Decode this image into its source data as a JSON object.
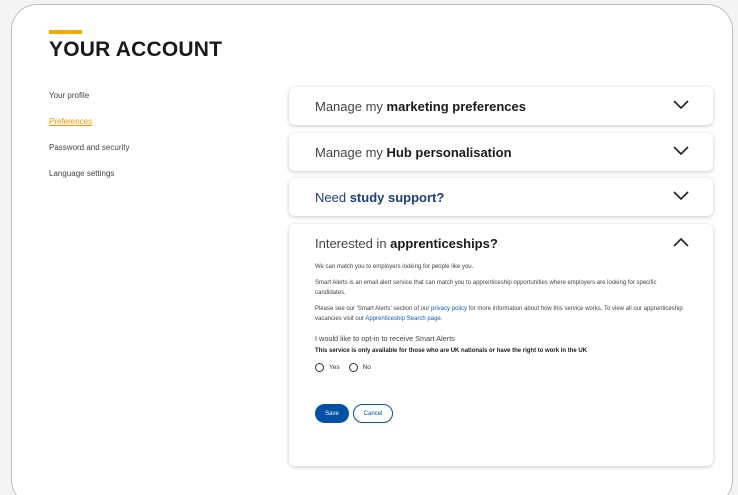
{
  "page": {
    "title": "YOUR ACCOUNT"
  },
  "nav": {
    "items": [
      {
        "label": "Your profile"
      },
      {
        "label": "Preferences",
        "active": true
      },
      {
        "label": "Password and security"
      },
      {
        "label": "Language settings"
      }
    ]
  },
  "accordions": [
    {
      "prefix": "Manage my ",
      "bold": "marketing preferences",
      "icon": "chevron-down-icon"
    },
    {
      "prefix": "Manage my ",
      "bold": "Hub personalisation",
      "icon": "chevron-down-icon"
    },
    {
      "prefix": "Need ",
      "bold": "study support?",
      "icon": "chevron-down-icon"
    },
    {
      "prefix": "Interested in ",
      "bold": "apprenticeships?",
      "icon": "chevron-up-icon",
      "intro": "We can match you to employers looking for people like you.",
      "smart_alerts": "Smart Alerts is an email alert service that can match you to apprenticeship opportunities where employers are looking for specific candidates.",
      "see_pre": "Please see our 'Smart Alerts' section of our ",
      "privacy_link": "privacy policy",
      "see_mid": " for more information about how this service works. To view all our apprenticeship vacancies visit our ",
      "search_link": "Apprenticeship Search page",
      "see_post": ".",
      "optin_label": "I would like to opt-in to receive Smart Alerts",
      "note": "This service is only available for those who are UK nationals or have the right to work in the UK",
      "yes_label": "Yes",
      "no_label": "No",
      "save_label": "Save",
      "cancel_label": "Cancel"
    }
  ],
  "colors": {
    "accent": "#f2a900",
    "link": "#0b5dbb",
    "primary_button": "#0051a4",
    "study_support": "#1d3f7a"
  }
}
